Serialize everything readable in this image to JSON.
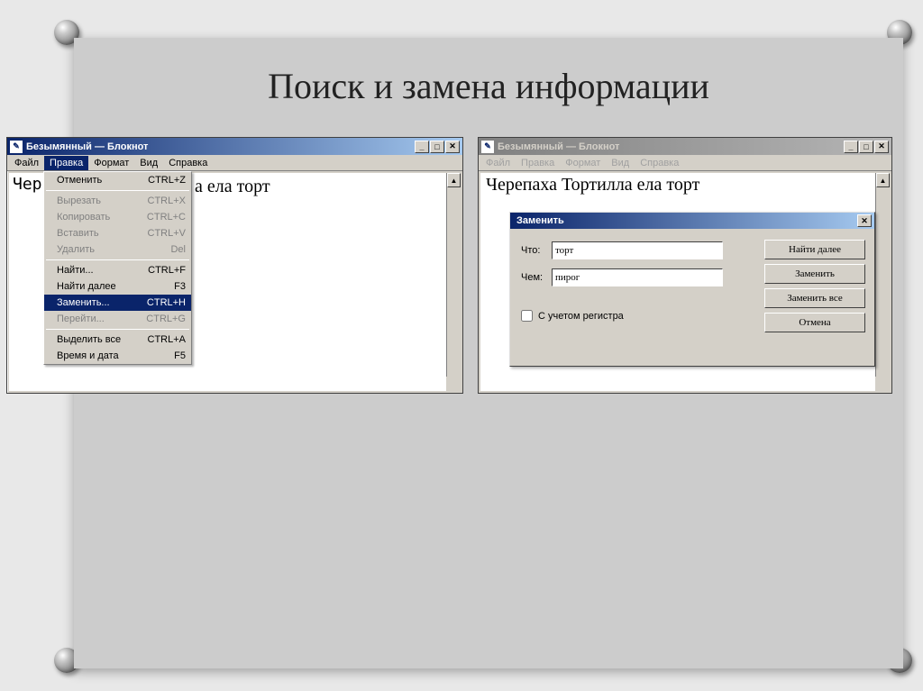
{
  "slide": {
    "title": "Поиск и замена информации"
  },
  "win1": {
    "title": "Безымянный — Блокнот",
    "menus": [
      "Файл",
      "Правка",
      "Формат",
      "Вид",
      "Справка"
    ],
    "content_visible": "а ела торт",
    "content_prefix": "Чер",
    "dropdown": {
      "items": [
        {
          "label": "Отменить",
          "shortcut": "CTRL+Z",
          "disabled": false
        },
        {
          "sep": true
        },
        {
          "label": "Вырезать",
          "shortcut": "CTRL+X",
          "disabled": true
        },
        {
          "label": "Копировать",
          "shortcut": "CTRL+C",
          "disabled": true
        },
        {
          "label": "Вставить",
          "shortcut": "CTRL+V",
          "disabled": true
        },
        {
          "label": "Удалить",
          "shortcut": "Del",
          "disabled": true
        },
        {
          "sep": true
        },
        {
          "label": "Найти...",
          "shortcut": "CTRL+F",
          "disabled": false
        },
        {
          "label": "Найти далее",
          "shortcut": "F3",
          "disabled": false
        },
        {
          "label": "Заменить...",
          "shortcut": "CTRL+H",
          "disabled": false,
          "highlight": true
        },
        {
          "label": "Перейти...",
          "shortcut": "CTRL+G",
          "disabled": true
        },
        {
          "sep": true
        },
        {
          "label": "Выделить все",
          "shortcut": "CTRL+A",
          "disabled": false
        },
        {
          "label": "Время и дата",
          "shortcut": "F5",
          "disabled": false
        }
      ]
    }
  },
  "win2": {
    "title": "Безымянный — Блокнот",
    "menus": [
      "Файл",
      "Правка",
      "Формат",
      "Вид",
      "Справка"
    ],
    "content": "Черепаха Тортилла ела торт",
    "dialog": {
      "title": "Заменить",
      "find_label": "Что:",
      "find_value": "торт",
      "replace_label": "Чем:",
      "replace_value": "пирог",
      "case_label": "С учетом регистра",
      "buttons": {
        "find_next": "Найти далее",
        "replace": "Заменить",
        "replace_all": "Заменить все",
        "cancel": "Отмена"
      }
    }
  },
  "window_controls": {
    "min": "_",
    "max": "□",
    "close": "✕"
  }
}
